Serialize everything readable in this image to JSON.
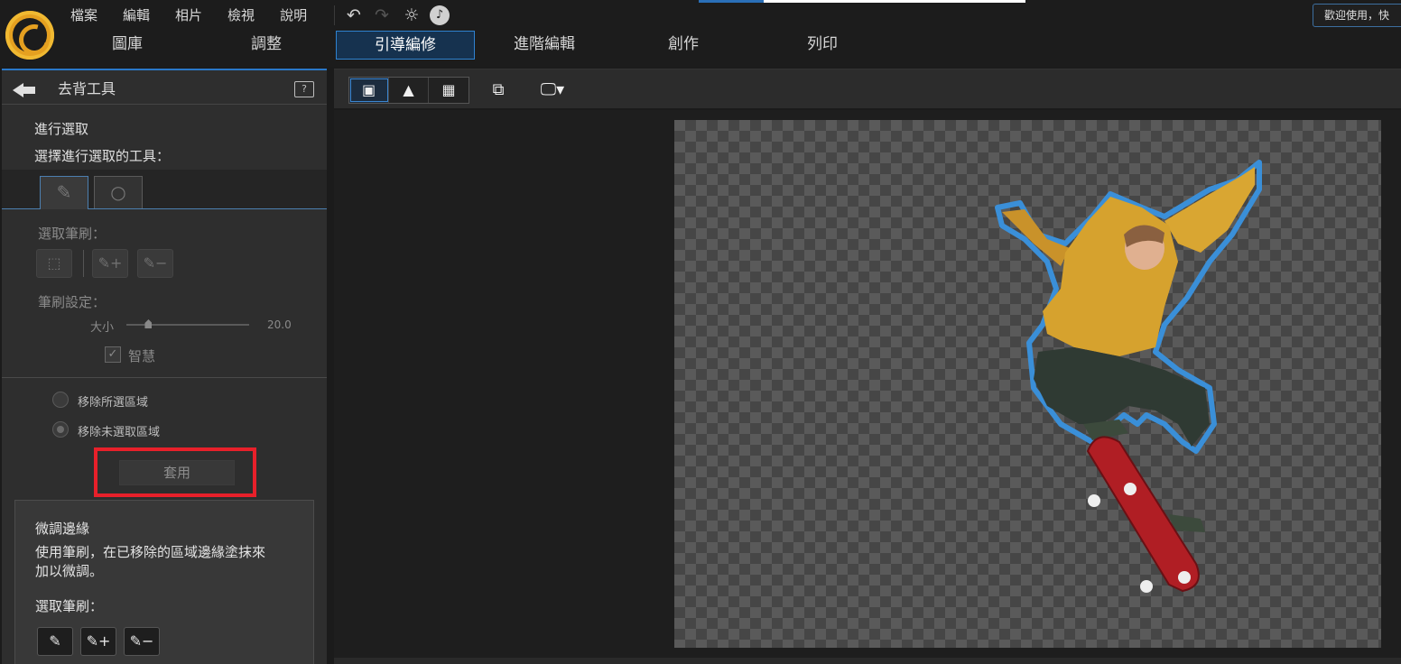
{
  "menubar": {
    "items": [
      "檔案",
      "編輯",
      "相片",
      "檢視",
      "說明"
    ]
  },
  "toolbar_icons": [
    "undo-icon",
    "redo-icon",
    "settings-icon",
    "notification-icon"
  ],
  "welcome_text": "歡迎使用，快",
  "nav_tabs": [
    {
      "label": "圖庫",
      "active": false
    },
    {
      "label": "調整",
      "active": false
    },
    {
      "label": "引導編修",
      "active": true
    },
    {
      "label": "進階編輯",
      "active": false
    },
    {
      "label": "創作",
      "active": false
    },
    {
      "label": "列印",
      "active": false
    }
  ],
  "left_panel": {
    "title": "去背工具",
    "help_label": "?",
    "selection_heading": "進行選取",
    "selection_subheading": "選擇進行選取的工具：",
    "brush_label": "選取筆刷：",
    "brush_settings_label": "筆刷設定：",
    "size_label": "大小",
    "size_value": "20.0",
    "size_fraction": 0.18,
    "smart_label": "智慧",
    "smart_checked": true,
    "radio_remove_selected": "移除所選區域",
    "radio_remove_unselected": "移除未選取區域",
    "radio_selected_index": 1,
    "apply_label": "套用",
    "refine": {
      "title": "微調邊緣",
      "desc_line1": "使用筆刷，在已移除的區域邊緣塗抹來",
      "desc_line2": "加以微調。",
      "brush_label": "選取筆刷："
    }
  },
  "colors": {
    "accent": "#2f82d0",
    "highlight_box": "#e8202a"
  }
}
